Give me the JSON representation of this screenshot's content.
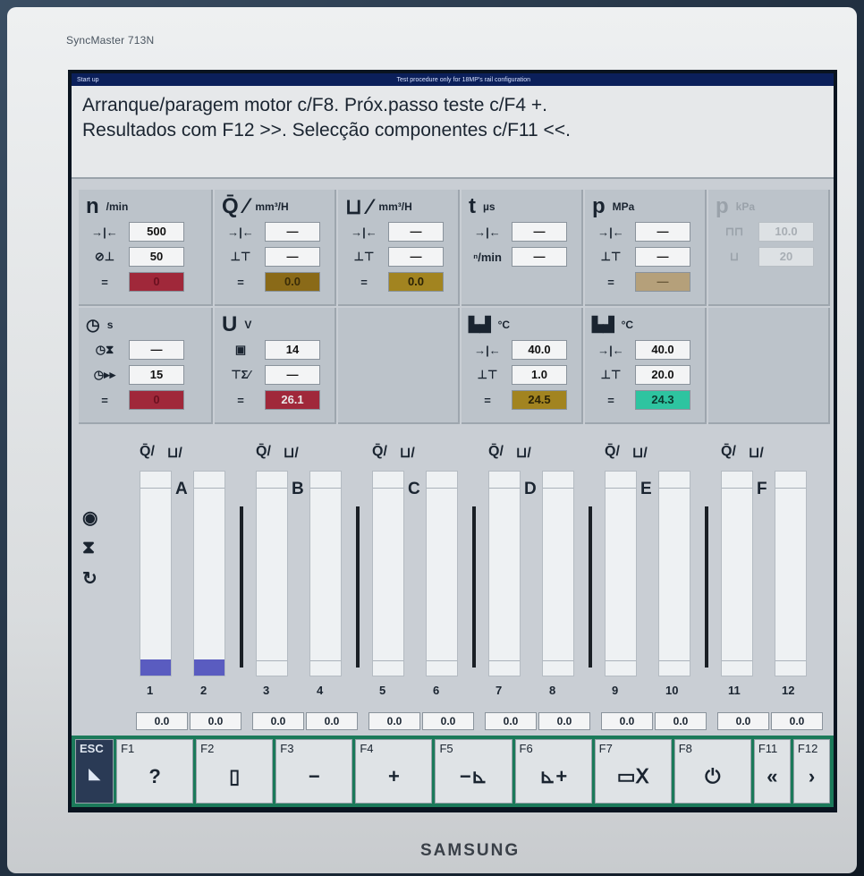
{
  "monitor": {
    "model": "SyncMaster 713N",
    "brand": "SAMSUNG"
  },
  "window": {
    "title": "Start up",
    "subtitle": "Test procedure only for 18MP's rail configuration"
  },
  "message": {
    "line1": "Arranque/paragem motor c/F8. Próx.passo teste c/F4 +.",
    "line2": "Resultados com F12 >>. Selecção componentes c/F11 <<."
  },
  "panels": {
    "rpm": {
      "symbol": "n",
      "unit": "/min",
      "v1": "500",
      "v2": "50",
      "v3": "0"
    },
    "time": {
      "symbol": "⏱",
      "unit": "s",
      "v1": "—",
      "v2": "15",
      "v3": "0"
    },
    "flow_q": {
      "symbol": "Q̄ ⁄",
      "unit": "mm³/H",
      "v1": "—",
      "v2": "—",
      "v3": "0.0"
    },
    "volt": {
      "symbol": "U",
      "unit": "V",
      "v1": "14",
      "v2": "—",
      "v3": "26.1"
    },
    "flow_r": {
      "symbol": "⊔ ⁄",
      "unit": "mm³/H",
      "v1": "—",
      "v2": "—",
      "v3": "0.0"
    },
    "pulse": {
      "symbol": "t",
      "unit": "µs",
      "v1": "—",
      "v2": "—",
      "rlabel2": "ⁿ/min"
    },
    "temp1": {
      "symbol": "🌡",
      "unit": "°C",
      "v1": "40.0",
      "v2": "1.0",
      "v3": "24.5"
    },
    "press": {
      "symbol": "p",
      "unit": "MPa",
      "v1": "—",
      "v2": "—",
      "v3": "—"
    },
    "temp2": {
      "symbol": "🌡",
      "unit": "°C",
      "v1": "40.0",
      "v2": "20.0",
      "v3": "24.3"
    },
    "kpa": {
      "symbol": "p",
      "unit": "kPa",
      "v1": "10.0",
      "v2": "20"
    }
  },
  "chart": {
    "group_labels": [
      "A",
      "B",
      "C",
      "D",
      "E",
      "F"
    ],
    "col_numbers": [
      "1",
      "2",
      "3",
      "4",
      "5",
      "6",
      "7",
      "8",
      "9",
      "10",
      "11",
      "12"
    ],
    "col_head_q": "Q̄/",
    "col_head_r": "⊔/",
    "values": [
      "0.0",
      "0.0",
      "0.0",
      "0.0",
      "0.0",
      "0.0",
      "0.0",
      "0.0",
      "0.0",
      "0.0",
      "0.0",
      "0.0"
    ],
    "fill_fraction": [
      0.08,
      0.08,
      0,
      0,
      0,
      0,
      0,
      0,
      0,
      0,
      0,
      0
    ]
  },
  "fkeys": [
    {
      "label": "ESC",
      "icon": "back-icon",
      "glyph": "◣"
    },
    {
      "label": "F1",
      "icon": "help-icon",
      "glyph": "?"
    },
    {
      "label": "F2",
      "icon": "clipboard-icon",
      "glyph": "▯"
    },
    {
      "label": "F3",
      "icon": "minus-icon",
      "glyph": "−"
    },
    {
      "label": "F4",
      "icon": "plus-icon",
      "glyph": "+"
    },
    {
      "label": "F5",
      "icon": "step-back-icon",
      "glyph": "−⊾"
    },
    {
      "label": "F6",
      "icon": "step-forward-icon",
      "glyph": "⊾+"
    },
    {
      "label": "F7",
      "icon": "injector-icon",
      "glyph": "▭Ⅹ"
    },
    {
      "label": "F8",
      "icon": "power-icon",
      "glyph": "⏻"
    },
    {
      "label": "F11",
      "icon": "prev-icon",
      "glyph": "«"
    },
    {
      "label": "F12",
      "icon": "next-icon",
      "glyph": "›"
    }
  ]
}
